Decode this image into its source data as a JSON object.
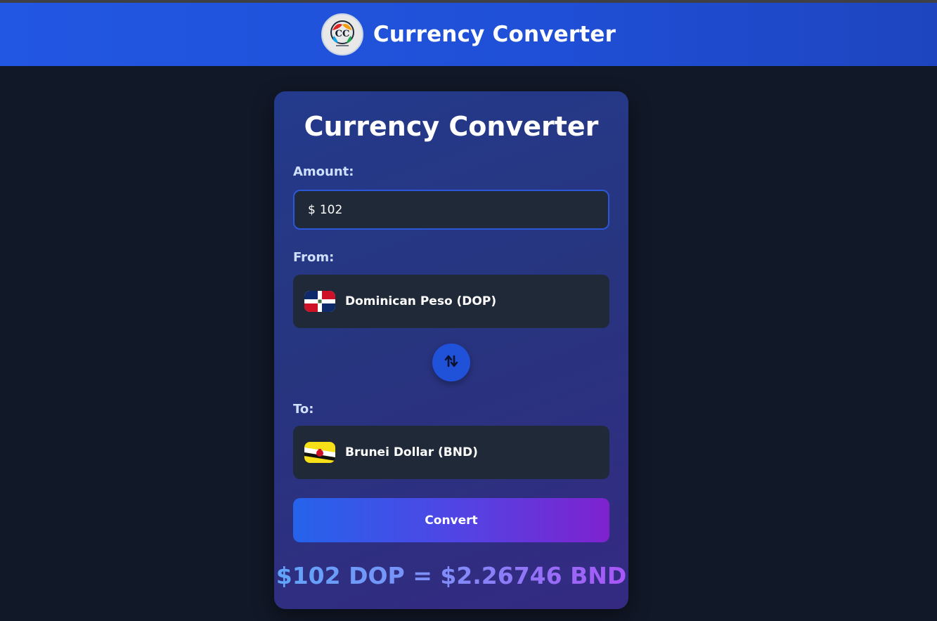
{
  "header": {
    "title": "Currency Converter",
    "logo_icon": "currency-converter-logo"
  },
  "card": {
    "title": "Currency Converter",
    "amount": {
      "label": "Amount:",
      "prefix": "$",
      "value": "102"
    },
    "from": {
      "label": "From:",
      "currency": "Dominican Peso (DOP)",
      "flag_icon": "dominican-republic-flag-icon"
    },
    "swap_icon": "swap-arrows-icon",
    "to": {
      "label": "To:",
      "currency": "Brunei Dollar (BND)",
      "flag_icon": "brunei-flag-icon"
    },
    "convert_label": "Convert",
    "result": "$102 DOP = $2.26746 BND"
  },
  "colors": {
    "background": "#111827",
    "header": "#2257e3",
    "card_start": "#243a8c",
    "card_end": "#342a82",
    "field_bg": "#1f2937",
    "accent": "#1f52d9",
    "button_start": "#2563eb",
    "button_end": "#7e22ce"
  }
}
